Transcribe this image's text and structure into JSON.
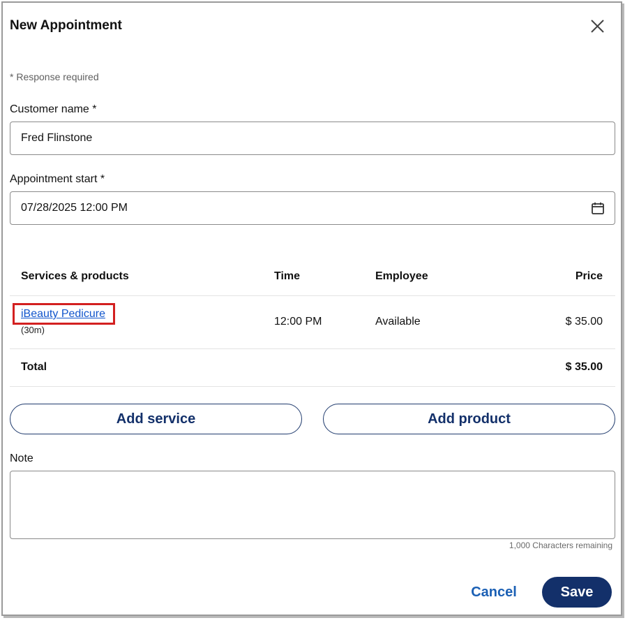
{
  "dialog": {
    "title": "New Appointment",
    "required_note": "* Response required"
  },
  "form": {
    "customer_name_label": "Customer name *",
    "customer_name_value": "Fred Flinstone",
    "appointment_start_label": "Appointment start *",
    "appointment_start_value": "07/28/2025 12:00 PM"
  },
  "table": {
    "headers": {
      "service": "Services & products",
      "time": "Time",
      "employee": "Employee",
      "price": "Price"
    },
    "rows": [
      {
        "service": "iBeauty Pedicure",
        "duration": "(30m)",
        "time": "12:00 PM",
        "employee": "Available",
        "price": "$ 35.00"
      }
    ],
    "total_label": "Total",
    "total_value": "$ 35.00"
  },
  "actions": {
    "add_service": "Add service",
    "add_product": "Add product"
  },
  "note": {
    "label": "Note",
    "chars_remaining": "1,000 Characters remaining"
  },
  "footer": {
    "cancel": "Cancel",
    "save": "Save"
  },
  "colors": {
    "primary": "#13306a",
    "link": "#1155cc",
    "highlight": "#d32020"
  }
}
